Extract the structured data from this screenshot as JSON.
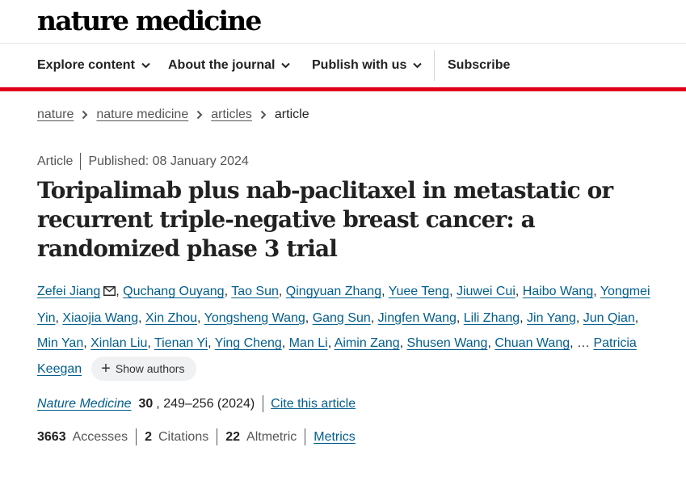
{
  "site": {
    "logo": "nature medicine"
  },
  "nav": {
    "explore": "Explore content",
    "about": "About the journal",
    "publish": "Publish with us",
    "subscribe": "Subscribe"
  },
  "breadcrumb": {
    "items": [
      "nature",
      "nature medicine",
      "articles"
    ],
    "current": "article"
  },
  "article": {
    "type": "Article",
    "published": "Published: 08 January 2024",
    "title": "Toripalimab plus nab-paclitaxel in metastatic or recurrent triple-negative breast cancer: a randomized phase 3 trial",
    "authors": [
      "Zefei Jiang",
      "Quchang Ouyang",
      "Tao Sun",
      "Qingyuan Zhang",
      "Yuee Teng",
      "Jiuwei Cui",
      "Haibo Wang",
      "Yongmei Yin",
      "Xiaojia Wang",
      "Xin Zhou",
      "Yongsheng Wang",
      "Gang Sun",
      "Jingfen Wang",
      "Lili Zhang",
      "Jin Yang",
      "Jun Qian",
      "Min Yan",
      "Xinlan Liu",
      "Tienan Yi",
      "Ying Cheng",
      "Man Li",
      "Aimin Zang",
      "Shusen Wang",
      "Chuan Wang"
    ],
    "ellipsis": "…",
    "last_author": "Patricia Keegan",
    "show_authors": "Show authors",
    "citation": {
      "journal": "Nature Medicine",
      "volume": "30",
      "pages": ", 249–256 (2024)",
      "cite": "Cite this article"
    },
    "metrics": {
      "accesses_value": "3663",
      "accesses_label": "Accesses",
      "citations_value": "2",
      "citations_label": "Citations",
      "altmetric_value": "22",
      "altmetric_label": "Altmetric",
      "metrics_link": "Metrics"
    }
  },
  "icons": {
    "nav_chevron": "chevron-down-icon",
    "breadcrumb_sep": "chevron-right-icon",
    "corresponding": "envelope-icon",
    "expand": "plus-icon"
  },
  "colors": {
    "accent_red": "#e0001b",
    "link_blue": "#025e8d"
  }
}
